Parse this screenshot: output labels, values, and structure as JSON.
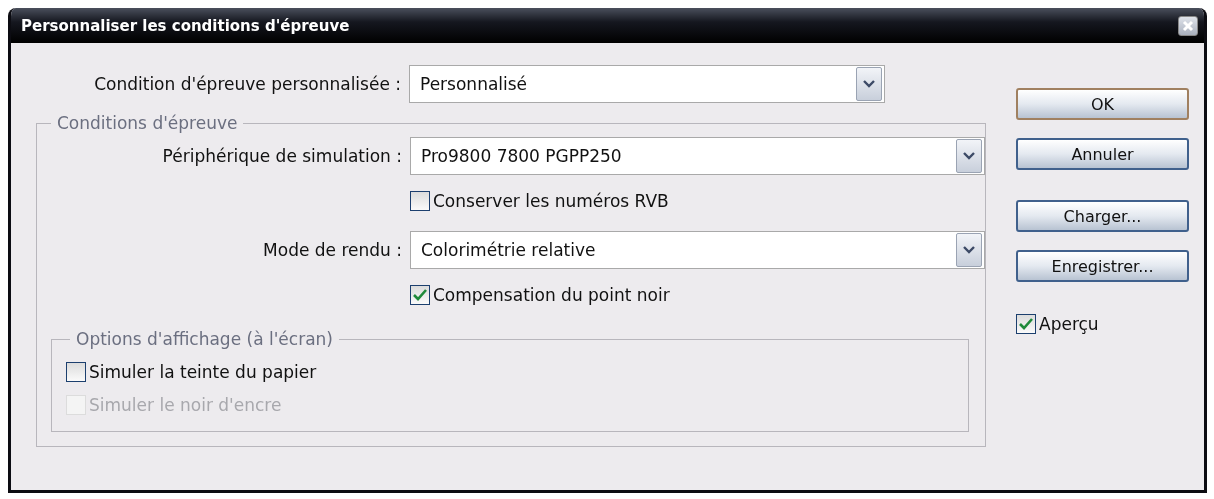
{
  "window": {
    "title": "Personnaliser les conditions d'épreuve"
  },
  "custom_condition": {
    "label": "Condition d'épreuve personnalisée :",
    "value": "Personnalisé"
  },
  "proof_conditions": {
    "legend": "Conditions d'épreuve",
    "fields": [
      {
        "kind": "select",
        "label": "Périphérique de simulation :",
        "value": "Pro9800 7800 PGPP250"
      },
      {
        "kind": "checkbox",
        "label": "Conserver les numéros RVB",
        "checked": false,
        "disabled": false
      },
      {
        "kind": "select",
        "label": "Mode de rendu :",
        "value": "Colorimétrie relative"
      },
      {
        "kind": "checkbox",
        "label": "Compensation du point noir",
        "checked": true,
        "disabled": false
      }
    ]
  },
  "display_options": {
    "legend": "Options d'affichage (à l'écran)",
    "options": [
      {
        "label": "Simuler la teinte du papier",
        "checked": false,
        "disabled": false
      },
      {
        "label": "Simuler le noir d'encre",
        "checked": false,
        "disabled": true
      }
    ]
  },
  "buttons": [
    {
      "label": "OK",
      "default": true
    },
    {
      "label": "Annuler",
      "default": false
    },
    {
      "label": "Charger...",
      "default": false
    },
    {
      "label": "Enregistrer...",
      "default": false
    }
  ],
  "preview": {
    "label": "Aperçu",
    "checked": true
  }
}
